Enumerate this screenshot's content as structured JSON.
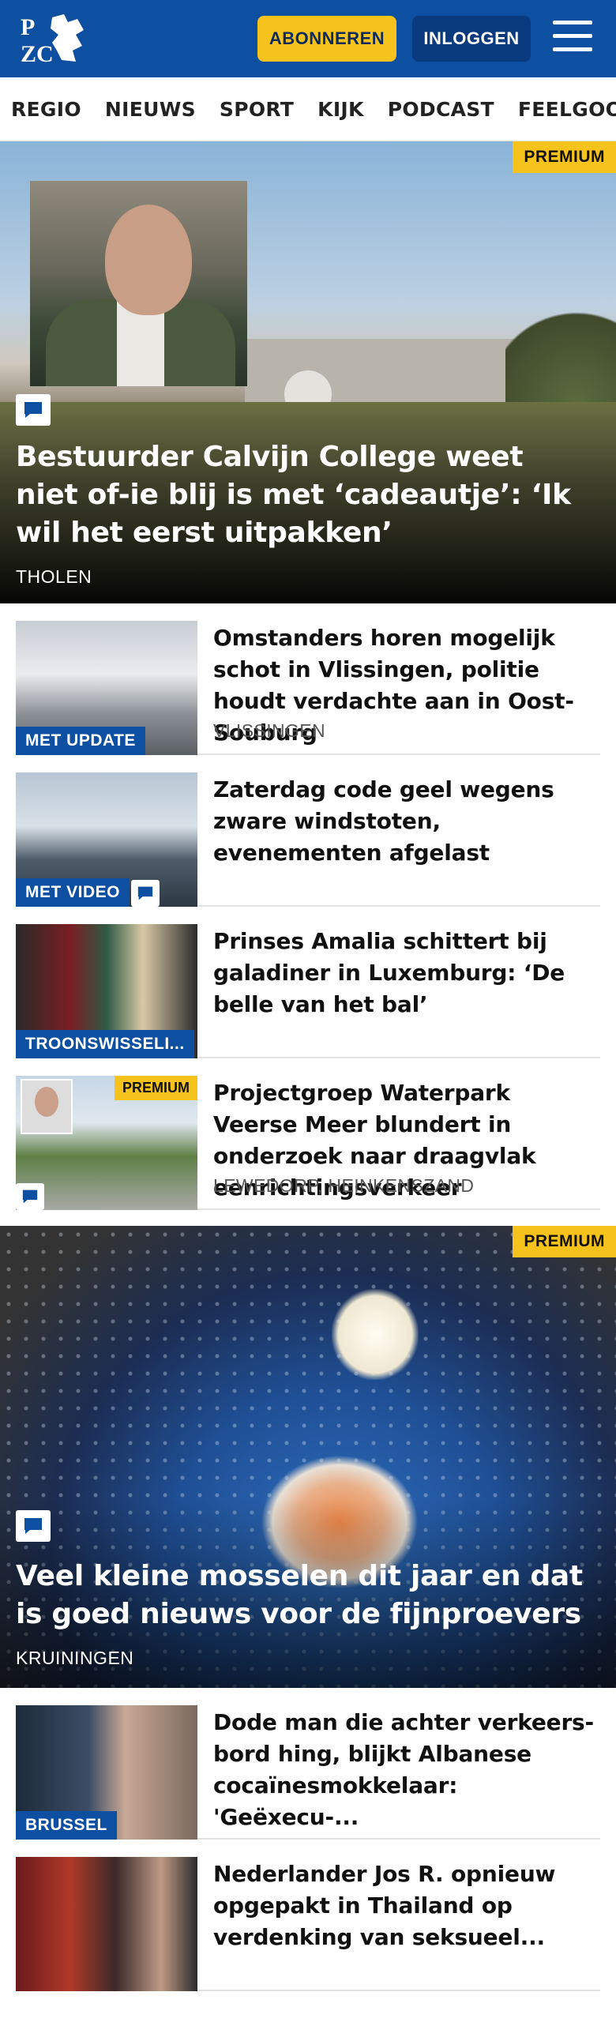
{
  "header": {
    "logo_text": "PZC",
    "subscribe_label": "ABONNEREN",
    "login_label": "INLOGGEN",
    "colors": {
      "brand_blue": "#0d4fa0",
      "accent_yellow": "#f6c31c"
    }
  },
  "nav": {
    "items": [
      "REGIO",
      "NIEUWS",
      "SPORT",
      "KIJK",
      "PODCAST",
      "FEELGOOD"
    ]
  },
  "hero1": {
    "badge": "PREMIUM",
    "title": "Bestuurder Calvijn College weet niet of-ie blij is met ‘cadeautje’: ‘Ik wil het eerst uitpakken’",
    "location": "THOLEN",
    "icon": "comment-icon"
  },
  "articles": [
    {
      "title": "Omstanders horen mogelijk schot in Vlissingen, politie houdt verdachte aan in Oost-Souburg",
      "location": "VLISSINGEN",
      "tag": "MET UPDATE"
    },
    {
      "title": "Zaterdag code geel wegens zware windstoten, evenementen afgelast",
      "tag": "MET VIDEO",
      "icon": "comment-icon"
    },
    {
      "title": "Prinses Amalia schittert bij galadiner in Luxemburg: ‘De belle van het bal’",
      "tag": "TROONSWISSELI..."
    },
    {
      "title": "Projectgroep Waterpark Veerse Meer blundert in onderzoek naar draagvlak eenrichtingsverkeer",
      "location": "LEWEDORP, HEINKENSZAND",
      "badge": "PREMIUM",
      "icon": "comment-icon"
    }
  ],
  "hero2": {
    "badge": "PREMIUM",
    "title": "Veel kleine mosselen dit jaar en dat is goed nieuws voor de fijnproevers",
    "location": "KRUININGEN",
    "icon": "comment-icon"
  },
  "articles2": [
    {
      "title": "Dode man die achter verkeers-bord hing, blijkt Albanese cocaïnesmokkelaar: 'Geëxecu-...",
      "tag": "BRUSSEL"
    },
    {
      "title": "Nederlander Jos R. opnieuw opgepakt in Thailand op verdenking van seksueel..."
    }
  ]
}
